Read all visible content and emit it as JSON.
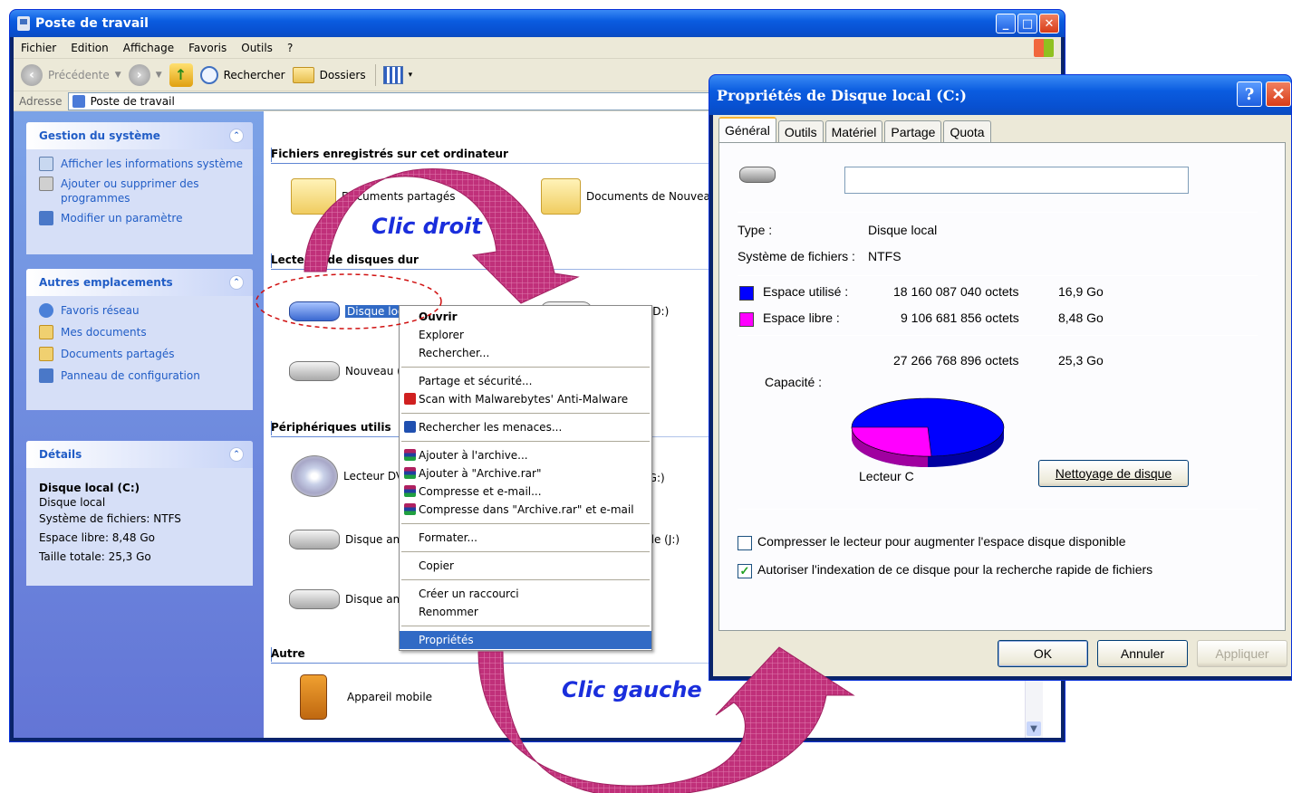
{
  "explorer": {
    "title": "Poste de travail",
    "menu": [
      "Fichier",
      "Edition",
      "Affichage",
      "Favoris",
      "Outils",
      "?"
    ],
    "toolbar": {
      "back_label": "Précédente",
      "search_label": "Rechercher",
      "folders_label": "Dossiers"
    },
    "address": {
      "label": "Adresse",
      "value": "Poste de travail"
    },
    "panels": {
      "system": {
        "title": "Gestion du système",
        "links": [
          "Afficher les informations système",
          "Ajouter ou supprimer des programmes",
          "Modifier un paramètre"
        ]
      },
      "places": {
        "title": "Autres emplacements",
        "links": [
          "Favoris réseau",
          "Mes documents",
          "Documents partagés",
          "Panneau de configuration"
        ]
      },
      "details": {
        "title": "Détails",
        "name": "Disque local (C:)",
        "type": "Disque local",
        "fs": "Système de fichiers: NTFS",
        "free": "Espace libre: 8,48 Go",
        "total": "Taille totale: 25,3 Go"
      }
    },
    "sections": {
      "files": "Fichiers enregistrés sur cet ordinateur",
      "drives": "Lecteurs de disques dur",
      "removable": "Périphériques utilis",
      "other": "Autre"
    },
    "items": {
      "shared_docs": "Documents partagés",
      "docs_new": "Documents de Nouveau",
      "local_disk": "Disque local (C:)",
      "data_disk": "Données (D:)",
      "new_disk": "Nouveau (",
      "dvd": "Lecteur DV",
      "dvd_suffix": "(G:)",
      "removable1": "Disque am",
      "removable1_suffix": "ble (J:)",
      "removable2": "Disque am",
      "mobile": "Appareil mobile"
    }
  },
  "context_menu": {
    "items": [
      "Ouvrir",
      "Explorer",
      "Rechercher...",
      "Partage et sécurité...",
      "Scan with Malwarebytes' Anti-Malware",
      "Rechercher les menaces...",
      "Ajouter à l'archive...",
      "Ajouter à \"Archive.rar\"",
      "Compresse et e-mail...",
      "Compresse dans \"Archive.rar\" et e-mail",
      "Formater...",
      "Copier",
      "Créer un raccourci",
      "Renommer",
      "Propriétés"
    ]
  },
  "dialog": {
    "title": "Propriétés de Disque local (C:)",
    "tabs": [
      "Général",
      "Outils",
      "Matériel",
      "Partage",
      "Quota"
    ],
    "type_label": "Type :",
    "type_value": "Disque local",
    "fs_label": "Système de fichiers :",
    "fs_value": "NTFS",
    "used_label": "Espace utilisé :",
    "used_bytes": "18 160 087 040 octets",
    "used_size": "16,9 Go",
    "free_label": "Espace libre :",
    "free_bytes": "9 106 681 856 octets",
    "free_size": "8,48 Go",
    "capacity_label": "Capacité :",
    "capacity_bytes": "27 266 768 896 octets",
    "capacity_size": "25,3 Go",
    "drive_label": "Lecteur C",
    "cleanup_button": "Nettoyage de disque",
    "compress_label": "Compresser le lecteur pour augmenter l'espace disque disponible",
    "index_label": "Autoriser l'indexation de ce disque pour la recherche rapide de fichiers",
    "ok": "OK",
    "cancel": "Annuler",
    "apply": "Appliquer",
    "used_fraction": 0.666,
    "colors": {
      "used": "#0000ff",
      "free": "#ff00ff"
    }
  },
  "annotations": {
    "right_click": "Clic droit",
    "left_click": "Clic gauche"
  }
}
